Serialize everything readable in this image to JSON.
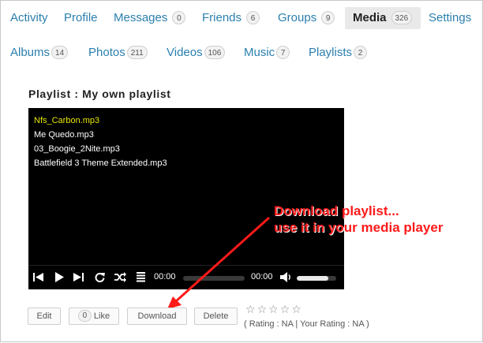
{
  "tabs": [
    {
      "label": "Activity",
      "badge": null
    },
    {
      "label": "Profile",
      "badge": null
    },
    {
      "label": "Messages",
      "badge": "0"
    },
    {
      "label": "Friends",
      "badge": "6"
    },
    {
      "label": "Groups",
      "badge": "9"
    },
    {
      "label": "Media",
      "badge": "326",
      "active": true
    },
    {
      "label": "Settings",
      "badge": null
    }
  ],
  "subtabs": [
    {
      "label": "Albums",
      "badge": "14"
    },
    {
      "label": "Photos",
      "badge": "211"
    },
    {
      "label": "Videos",
      "badge": "106"
    },
    {
      "label": "Music",
      "badge": "7"
    },
    {
      "label": "Playlists",
      "badge": "2"
    }
  ],
  "playlist": {
    "title": "Playlist : My own playlist",
    "tracks": [
      {
        "name": "Nfs_Carbon.mp3",
        "current": true
      },
      {
        "name": "Me Quedo.mp3"
      },
      {
        "name": "03_Boogie_2Nite.mp3"
      },
      {
        "name": "Battlefield 3 Theme Extended.mp3"
      }
    ],
    "player": {
      "time_elapsed": "00:00",
      "time_total": "00:00",
      "volume_level": 0.8
    }
  },
  "annotation": {
    "line1": "Download playlist...",
    "line2": "use it in your media player",
    "color": "#ff1a1a"
  },
  "actions": {
    "edit_label": "Edit",
    "like_count": "0",
    "like_label": "Like",
    "download_label": "Download",
    "delete_label": "Delete"
  },
  "rating": {
    "stars_total": 5,
    "text_prefix": "( Rating : NA",
    "separator": "|",
    "text_suffix": "Your Rating : NA )"
  },
  "colors": {
    "link": "#2a7fae",
    "current_track": "#e6e600"
  }
}
